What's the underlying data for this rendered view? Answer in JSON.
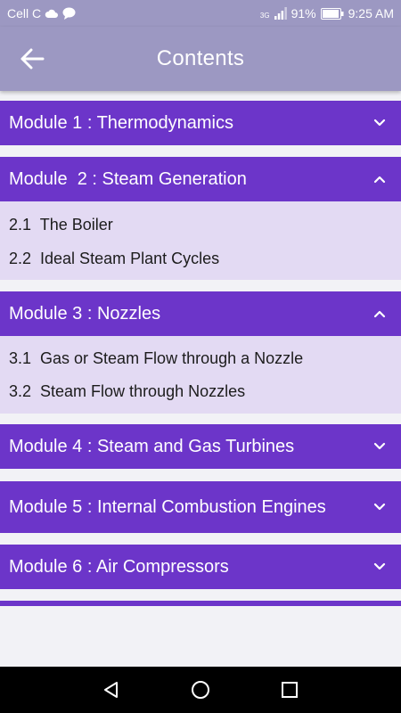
{
  "status_bar": {
    "carrier": "Cell C",
    "network": "3G",
    "battery": "91%",
    "time": "9:25 AM"
  },
  "app_bar": {
    "title": "Contents",
    "back_icon": "arrow-left-icon"
  },
  "modules": [
    {
      "title": "Module 1 : Thermodynamics",
      "expanded": false,
      "items": []
    },
    {
      "title": "Module  2 : Steam Generation",
      "expanded": true,
      "items": [
        "2.1  The Boiler",
        "2.2  Ideal Steam Plant Cycles"
      ]
    },
    {
      "title": "Module 3 : Nozzles",
      "expanded": true,
      "items": [
        "3.1  Gas or Steam Flow through a Nozzle",
        "3.2  Steam Flow through Nozzles"
      ]
    },
    {
      "title": "Module 4 : Steam and Gas Turbines",
      "expanded": false,
      "items": []
    },
    {
      "title": "Module 5 : Internal Combustion Engines",
      "expanded": false,
      "items": []
    },
    {
      "title": "Module 6 : Air Compressors",
      "expanded": false,
      "items": []
    }
  ],
  "nav_bar": {
    "back": "triangle-back-icon",
    "home": "circle-home-icon",
    "recents": "square-recents-icon"
  },
  "colors": {
    "header_bar": "#9c98c2",
    "module_header": "#6c35c9",
    "module_body": "#e3daf3",
    "background": "#f2f2f6"
  }
}
